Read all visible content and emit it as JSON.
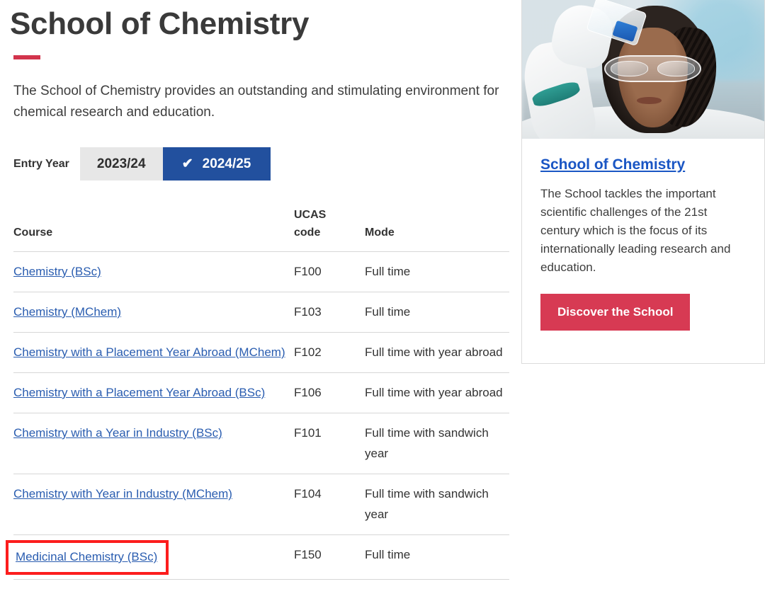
{
  "page": {
    "title": "School of Chemistry",
    "intro": "The School of Chemistry provides an outstanding and stimulating environment for chemical research and education."
  },
  "entry_year": {
    "label": "Entry Year",
    "options": [
      {
        "label": "2023/24",
        "selected": false
      },
      {
        "label": "2024/25",
        "selected": true
      }
    ],
    "check_glyph": "✔",
    "active_color": "#22509e",
    "inactive_color": "#e7e7e7"
  },
  "table": {
    "headers": {
      "course": "Course",
      "ucas_line1": "UCAS",
      "ucas_line2": "code",
      "mode": "Mode"
    },
    "rows": [
      {
        "course": "Chemistry (BSc)",
        "ucas": "F100",
        "mode": "Full time",
        "highlighted": false
      },
      {
        "course": "Chemistry (MChem)",
        "ucas": "F103",
        "mode": "Full time",
        "highlighted": false
      },
      {
        "course": "Chemistry with a Placement Year Abroad (MChem)",
        "ucas": "F102",
        "mode": "Full time with year abroad",
        "highlighted": false
      },
      {
        "course": "Chemistry with a Placement Year Abroad (BSc)",
        "ucas": "F106",
        "mode": "Full time with year abroad",
        "highlighted": false
      },
      {
        "course": "Chemistry with a Year in Industry (BSc)",
        "ucas": "F101",
        "mode": "Full time with sandwich year",
        "highlighted": false
      },
      {
        "course": "Chemistry with Year in Industry (MChem)",
        "ucas": "F104",
        "mode": "Full time with sandwich year",
        "highlighted": false
      },
      {
        "course": "Medicinal Chemistry (BSc)",
        "ucas": "F150",
        "mode": "Full time",
        "highlighted": true
      }
    ],
    "link_color": "#2a5db0",
    "highlight_color": "#fc1d1d"
  },
  "side_card": {
    "photo_alt": "scientist-in-lab-photo",
    "heading": "School of Chemistry",
    "body": "The School tackles the important scientific challenges of the 21st century which is the focus of its internationally leading research and education.",
    "button_label": "Discover the School",
    "button_color": "#d73a53",
    "heading_color": "#1a56c4"
  },
  "accent_bar_color": "#d2344c"
}
